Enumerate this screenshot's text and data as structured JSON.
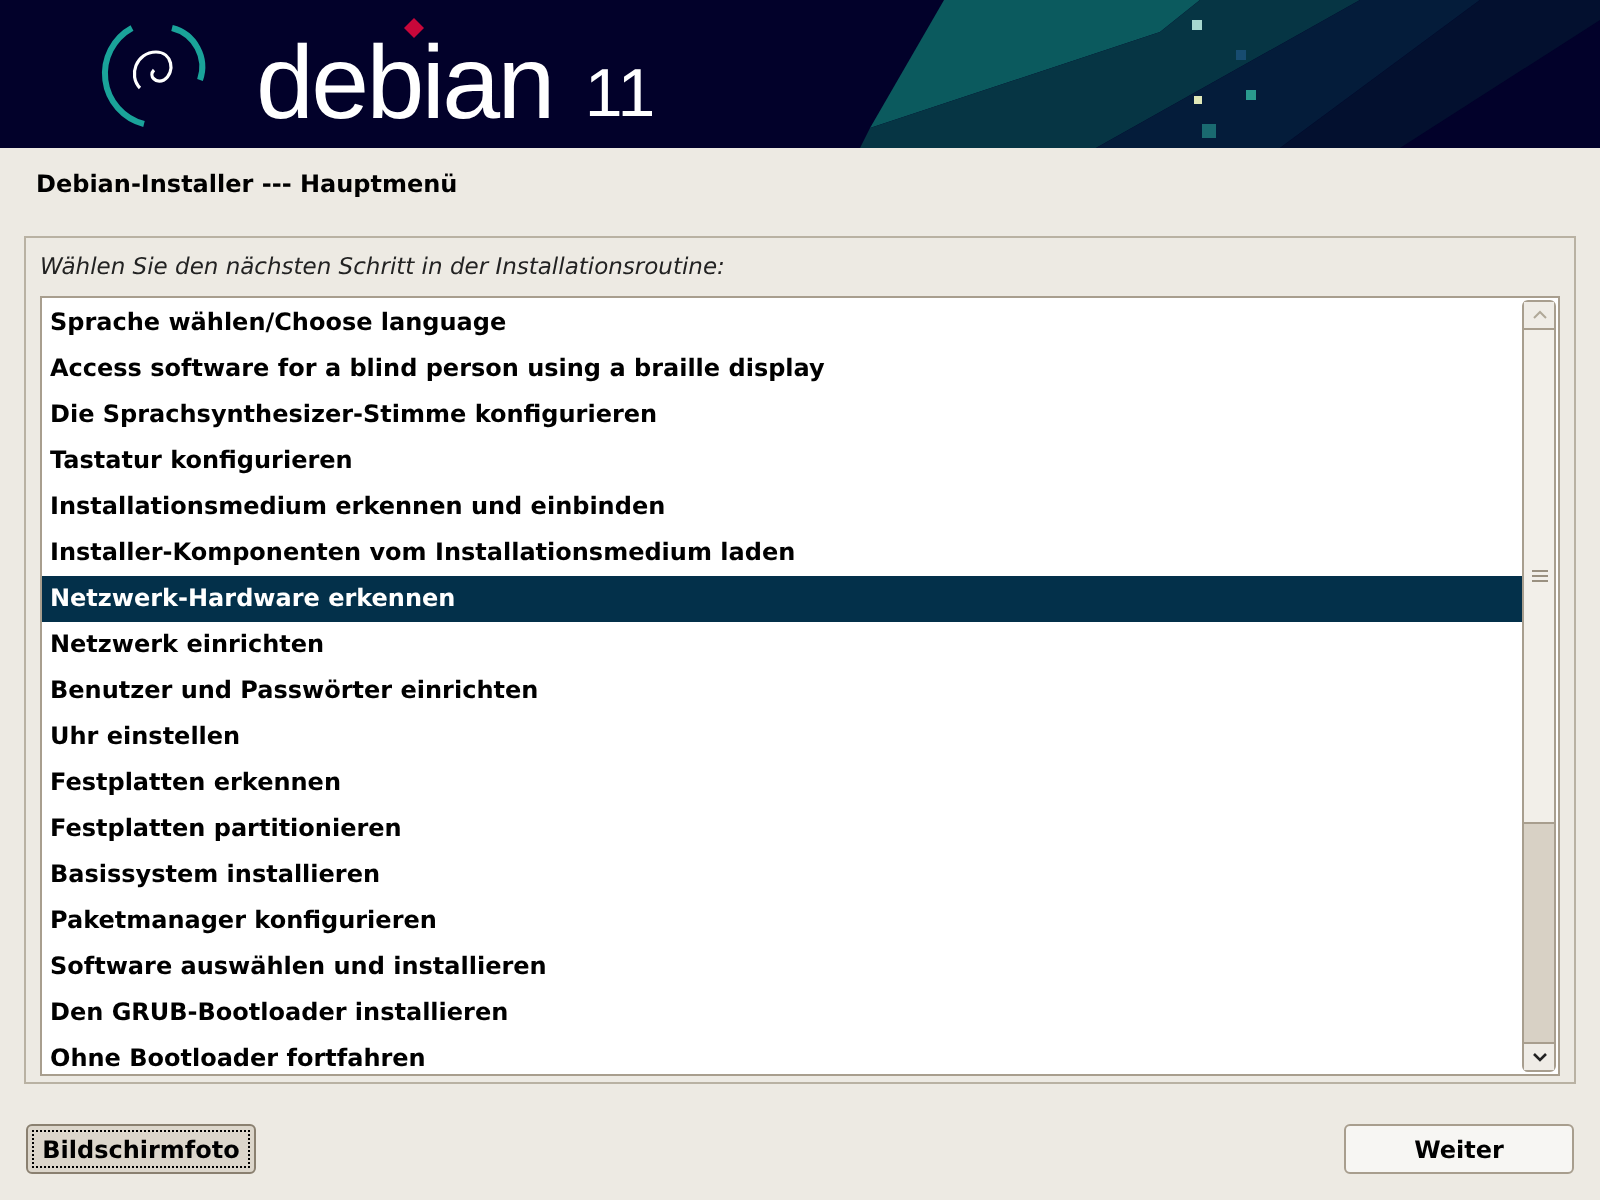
{
  "banner": {
    "logo_text": "debian",
    "version": "11"
  },
  "window": {
    "title": "Debian-Installer --- Hauptmenü"
  },
  "prompt": "Wählen Sie den nächsten Schritt in der Installationsroutine:",
  "menu_items": [
    {
      "label": "Sprache wählen/Choose language",
      "selected": false
    },
    {
      "label": "Access software for a blind person using a braille display",
      "selected": false
    },
    {
      "label": "Die Sprachsynthesizer-Stimme konfigurieren",
      "selected": false
    },
    {
      "label": "Tastatur konfigurieren",
      "selected": false
    },
    {
      "label": "Installationsmedium erkennen und einbinden",
      "selected": false
    },
    {
      "label": "Installer-Komponenten vom Installationsmedium laden",
      "selected": false
    },
    {
      "label": "Netzwerk-Hardware erkennen",
      "selected": true
    },
    {
      "label": "Netzwerk einrichten",
      "selected": false
    },
    {
      "label": "Benutzer und Passwörter einrichten",
      "selected": false
    },
    {
      "label": "Uhr einstellen",
      "selected": false
    },
    {
      "label": "Festplatten erkennen",
      "selected": false
    },
    {
      "label": "Festplatten partitionieren",
      "selected": false
    },
    {
      "label": "Basissystem installieren",
      "selected": false
    },
    {
      "label": "Paketmanager konfigurieren",
      "selected": false
    },
    {
      "label": "Software auswählen und installieren",
      "selected": false
    },
    {
      "label": "Den GRUB-Bootloader installieren",
      "selected": false
    },
    {
      "label": "Ohne Bootloader fortfahren",
      "selected": false
    }
  ],
  "buttons": [
    {
      "label": "Bildschirmfoto",
      "focused": true
    },
    {
      "label": "Weiter",
      "focused": false
    }
  ]
}
